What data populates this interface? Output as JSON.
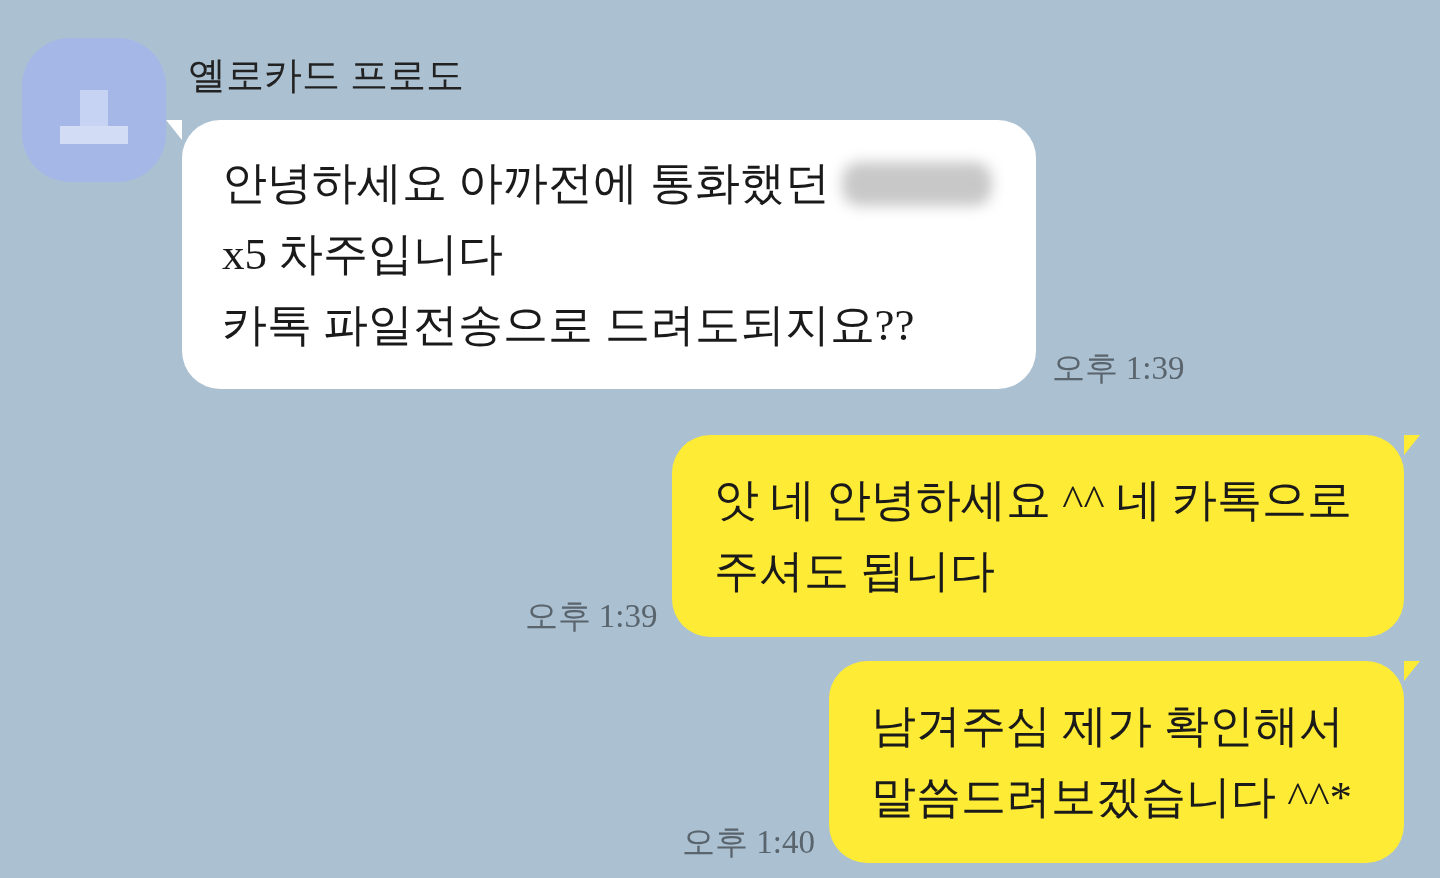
{
  "contact": {
    "name": "옐로카드 프로도"
  },
  "messages": [
    {
      "kind": "incoming",
      "lines": [
        {
          "text": "안녕하세요 아까전에 통화했던",
          "redacted": true
        },
        {
          "text": "x5 차주입니다",
          "redacted": false
        },
        {
          "text": "카톡 파일전송으로 드려도되지요??",
          "redacted": false
        }
      ],
      "time": "오후 1:39"
    },
    {
      "kind": "outgoing",
      "lines": [
        {
          "text": "앗 네 안녕하세요 ^^ 네 카톡으로",
          "redacted": false
        },
        {
          "text": "주셔도 됩니다",
          "redacted": false
        }
      ],
      "time": "오후 1:39"
    },
    {
      "kind": "outgoing",
      "lines": [
        {
          "text": "남겨주심 제가 확인해서",
          "redacted": false
        },
        {
          "text": "말씀드려보겠습니다 ^^*",
          "redacted": false
        }
      ],
      "time": "오후 1:40"
    }
  ]
}
